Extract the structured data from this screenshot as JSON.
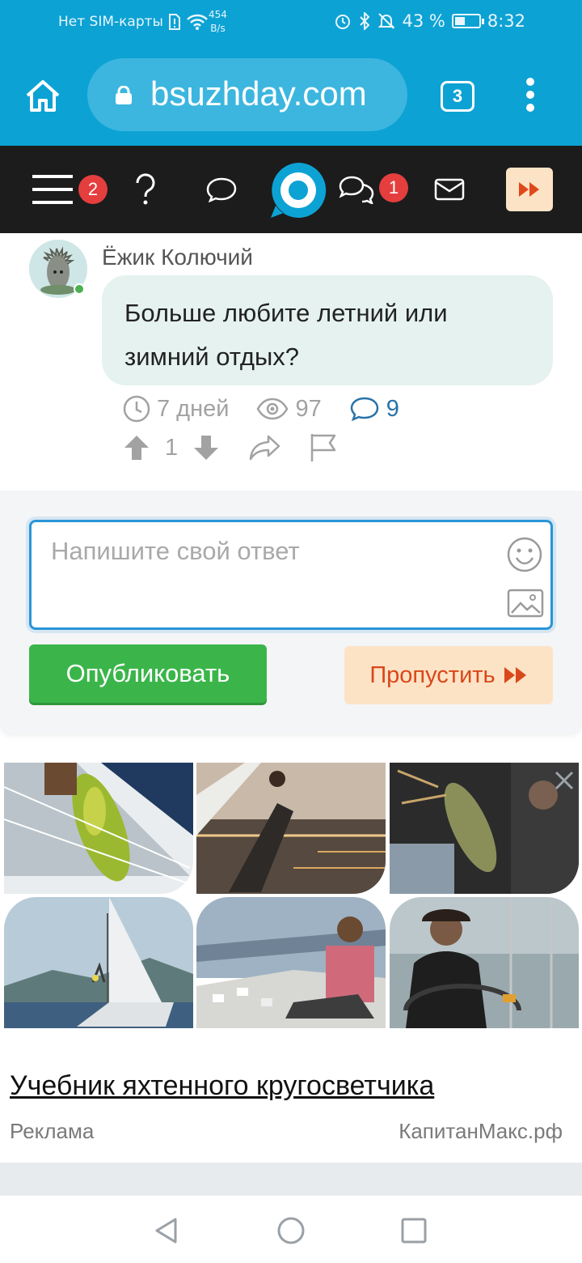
{
  "status_bar": {
    "carrier": "Нет SIM-карты",
    "speed_value": "454",
    "speed_unit": "B/s",
    "battery": "43 %",
    "battery_level": 0.43,
    "time": "8:32"
  },
  "browser": {
    "url": "bsuzhday.com",
    "tab_count": "3"
  },
  "site_nav": {
    "menu_badge": "2",
    "chat_badge": "1"
  },
  "question": {
    "author": "Ёжик Колючий",
    "text": "Больше любите летний или зимний отдых?",
    "age": "7 дней",
    "views": "97",
    "comments": "9",
    "votes": "1"
  },
  "reply": {
    "placeholder": "Напишите свой ответ",
    "publish_label": "Опубликовать",
    "skip_label": "Пропустить"
  },
  "ad": {
    "title": "Учебник яхтенного кругосветчика",
    "label": "Реклама",
    "domain": "КапитанМакс.рф"
  },
  "colors": {
    "browser_bar": "#0da2d4",
    "site_nav": "#1c1c1c",
    "publish_button": "#3bb54a",
    "skip_button_bg": "#fde3c5",
    "skip_button_text": "#d9481b",
    "badge": "#e53e3e",
    "bubble": "#e5f2ef"
  }
}
